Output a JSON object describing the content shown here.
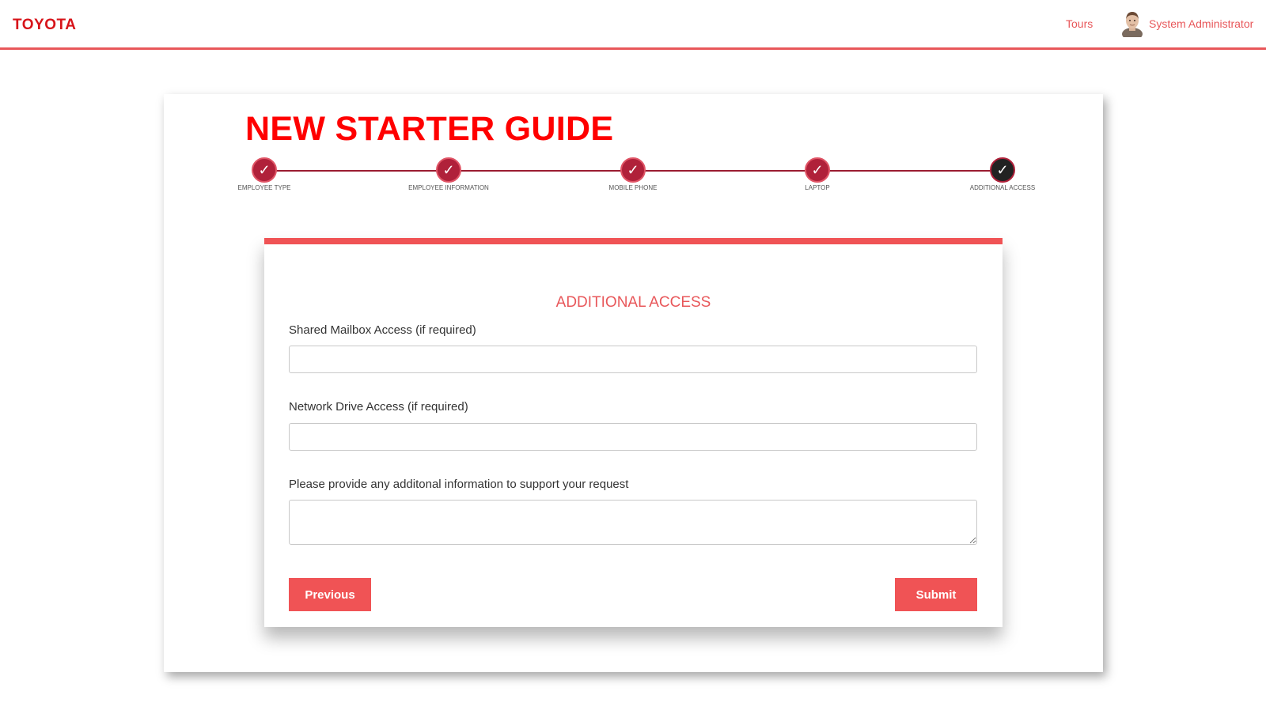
{
  "header": {
    "logo_text": "TOYOTA",
    "tours_label": "Tours",
    "user_name": "System Administrator",
    "avatar_icon": "user-avatar-icon"
  },
  "guide": {
    "title": "NEW STARTER GUIDE",
    "steps": [
      {
        "label": "EMPLOYEE TYPE",
        "status": "completed",
        "icon": "checkmark-icon"
      },
      {
        "label": "EMPLOYEE INFORMATION",
        "status": "completed",
        "icon": "checkmark-icon"
      },
      {
        "label": "MOBILE PHONE",
        "status": "completed",
        "icon": "checkmark-icon"
      },
      {
        "label": "LAPTOP",
        "status": "completed",
        "icon": "checkmark-icon"
      },
      {
        "label": "ADDITIONAL ACCESS",
        "status": "active",
        "icon": "checkmark-icon"
      }
    ]
  },
  "form": {
    "heading": "ADDITIONAL ACCESS",
    "fields": {
      "shared_mailbox": {
        "label": "Shared Mailbox Access (if required)",
        "value": "",
        "placeholder": ""
      },
      "network_drive": {
        "label": "Network Drive Access (if required)",
        "value": "",
        "placeholder": ""
      },
      "additional_info": {
        "label": "Please provide any additonal information to support your request",
        "value": "",
        "placeholder": ""
      }
    },
    "previous_label": "Previous",
    "submit_label": "Submit"
  },
  "colors": {
    "brand_red": "#d7141a",
    "accent": "#f05355",
    "step_complete": "#b0213a",
    "step_active": "#222222"
  }
}
